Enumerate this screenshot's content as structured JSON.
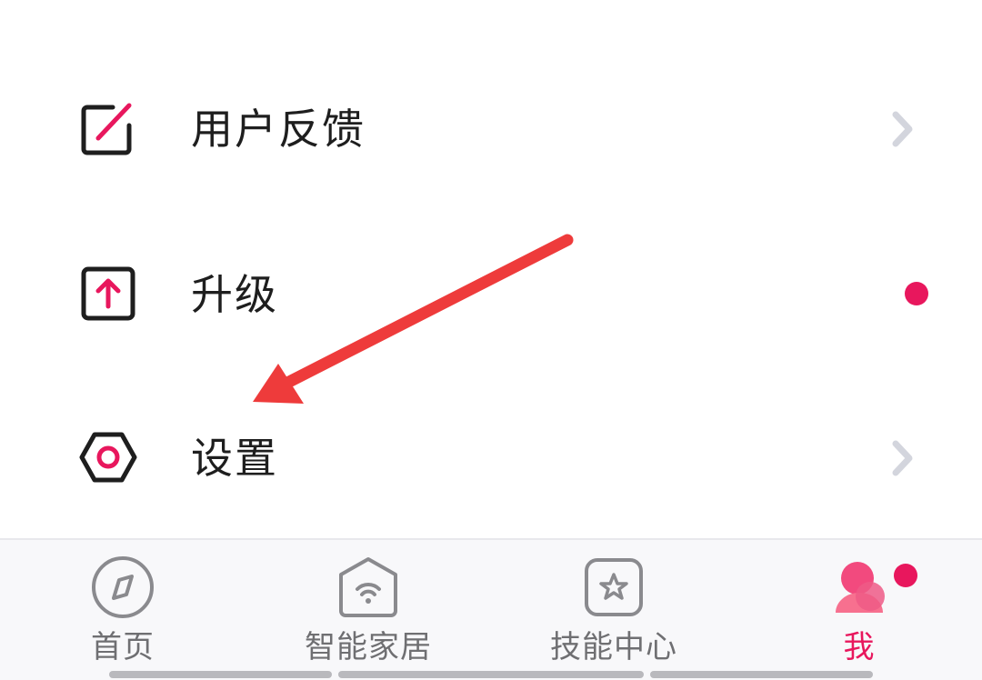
{
  "colors": {
    "accent": "#e8175d",
    "text": "#1e1e1e",
    "chevron": "#d3d5dd",
    "tab_inactive": "#6f6f72",
    "annotation_arrow": "#ee3b3b"
  },
  "menu": {
    "items": [
      {
        "label": "用户反馈",
        "icon": "edit-square-icon",
        "trailing": "chevron-right-icon"
      },
      {
        "label": "升级",
        "icon": "upload-arrow-icon",
        "trailing": "red-dot-badge"
      },
      {
        "label": "设置",
        "icon": "hexagon-settings-icon",
        "trailing": "chevron-right-icon"
      }
    ]
  },
  "annotation": {
    "type": "arrow",
    "points_to": "设置"
  },
  "tabbar": {
    "tabs": [
      {
        "label": "首页",
        "icon": "compass-icon",
        "active": false
      },
      {
        "label": "智能家居",
        "icon": "smart-home-wifi-icon",
        "active": false
      },
      {
        "label": "技能中心",
        "icon": "skill-star-icon",
        "active": false
      },
      {
        "label": "我",
        "icon": "profile-avatar-icon",
        "active": true,
        "badge": "red-dot"
      }
    ]
  }
}
